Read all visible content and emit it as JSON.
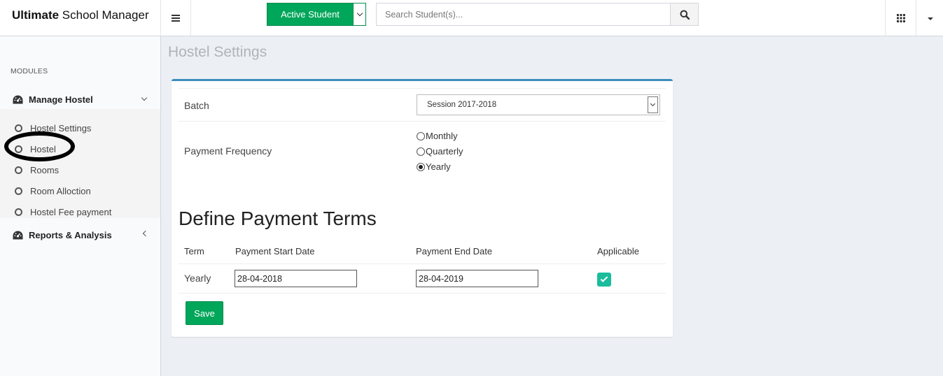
{
  "header": {
    "brand_bold": "Ultimate",
    "brand_rest": " School Manager",
    "active_button": "Active Student",
    "search_placeholder": "Search Student(s)..."
  },
  "sidebar": {
    "section_label": "MODULES",
    "groups": [
      {
        "label": "Manage Hostel",
        "expanded": true,
        "items": [
          {
            "label": "Hostel Settings"
          },
          {
            "label": "Hostel"
          },
          {
            "label": "Rooms"
          },
          {
            "label": "Room Alloction"
          },
          {
            "label": "Hostel Fee payment"
          }
        ]
      },
      {
        "label": "Reports & Analysis",
        "expanded": false
      }
    ]
  },
  "page": {
    "title": "Hostel Settings",
    "batch_label": "Batch",
    "batch_value": "Session 2017-2018",
    "frequency_label": "Payment Frequency",
    "frequency_options": [
      {
        "label": "Monthly",
        "selected": false
      },
      {
        "label": "Quarterly",
        "selected": false
      },
      {
        "label": "Yearly",
        "selected": true
      }
    ],
    "terms_title": "Define Payment Terms",
    "table": {
      "headers": [
        "Term",
        "Payment Start Date",
        "Payment End Date",
        "Applicable"
      ],
      "rows": [
        {
          "term": "Yearly",
          "start": "28-04-2018",
          "end": "28-04-2019",
          "applicable": true
        }
      ]
    },
    "save_label": "Save"
  },
  "colors": {
    "accent_green": "#00a65a",
    "box_top_border": "#3c8dbc",
    "checkbox_teal": "#1abc9c",
    "page_background": "#ecf0f5"
  }
}
